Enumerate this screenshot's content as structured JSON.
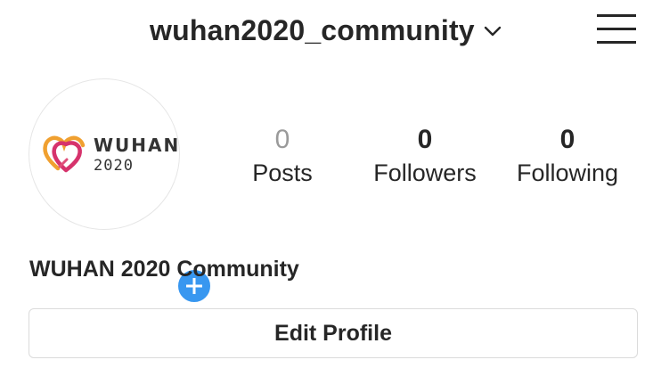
{
  "header": {
    "username": "wuhan2020_community",
    "dropdown_icon": "chevron-down-icon",
    "menu_icon": "hamburger-menu-icon"
  },
  "profile": {
    "avatar_logo": {
      "title": "WUHAN",
      "year": "2020"
    },
    "add_icon": "plus-icon",
    "display_name": "WUHAN 2020 Community"
  },
  "stats": [
    {
      "value": "0",
      "label": "Posts"
    },
    {
      "value": "0",
      "label": "Followers"
    },
    {
      "value": "0",
      "label": "Following"
    }
  ],
  "actions": {
    "edit_profile_label": "Edit Profile"
  },
  "colors": {
    "text": "#262626",
    "muted_count": "#9a9a9a",
    "add_button": "#3897f0",
    "border": "#dbdbdb",
    "logo_heart_orange": "#f0a030",
    "logo_heart_pink": "#d6336c"
  }
}
